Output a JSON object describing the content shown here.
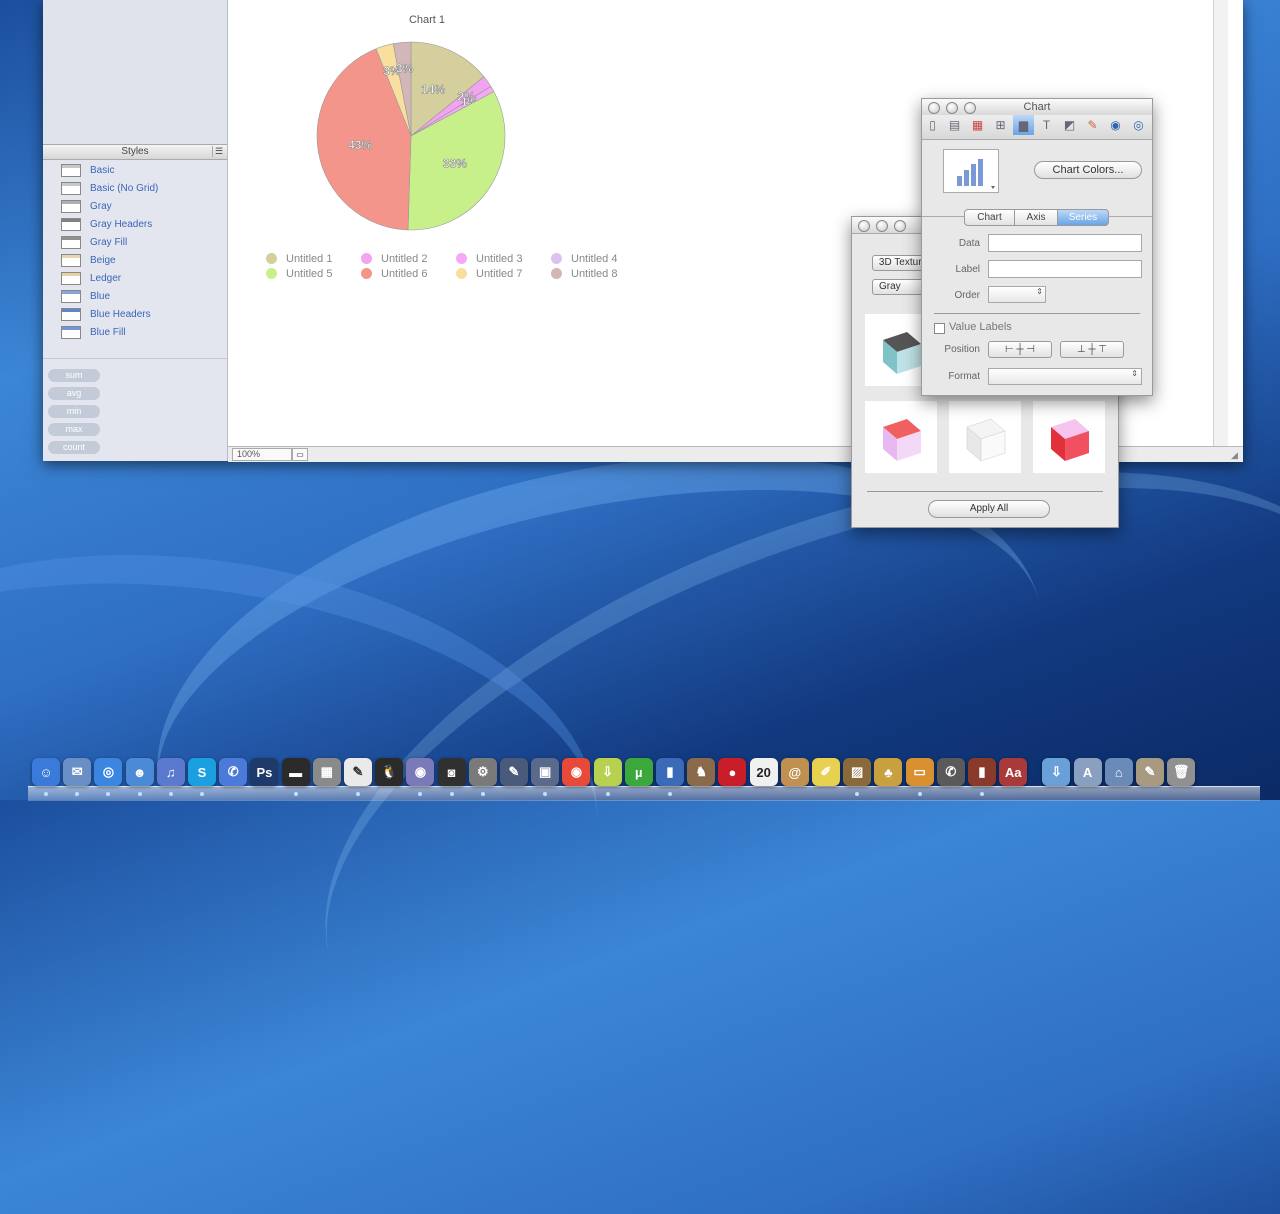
{
  "sidebar": {
    "styles_header": "Styles",
    "styles": [
      {
        "label": "Basic",
        "header_color": "#c8c8c8"
      },
      {
        "label": "Basic (No Grid)",
        "header_color": "#c8c8c8"
      },
      {
        "label": "Gray",
        "header_color": "#b0b0b0"
      },
      {
        "label": "Gray Headers",
        "header_color": "#808080"
      },
      {
        "label": "Gray Fill",
        "header_color": "#909090"
      },
      {
        "label": "Beige",
        "header_color": "#e8d6b0"
      },
      {
        "label": "Ledger",
        "header_color": "#e6d2a0"
      },
      {
        "label": "Blue",
        "header_color": "#8aa6d8"
      },
      {
        "label": "Blue Headers",
        "header_color": "#5e86cc"
      },
      {
        "label": "Blue Fill",
        "header_color": "#6e96d8"
      }
    ],
    "functions": [
      "sum",
      "avg",
      "min",
      "max",
      "count"
    ]
  },
  "status": {
    "zoom": "100%"
  },
  "chart_data": {
    "type": "pie",
    "title": "Chart 1",
    "slices": [
      {
        "name": "Untitled 1",
        "value": 14,
        "color": "#d4cf9c"
      },
      {
        "name": "Untitled 2",
        "value": 2,
        "color": "#f2a4f0"
      },
      {
        "name": "Untitled 3",
        "value": 1,
        "color": "#f4a8f6"
      },
      {
        "name": "Untitled 5",
        "value": 33,
        "color": "#c8f08a"
      },
      {
        "name": "Untitled 6",
        "value": 43,
        "color": "#f4958c"
      },
      {
        "name": "Untitled 7",
        "value": 3,
        "color": "#f8df9e"
      },
      {
        "name": "Untitled 8",
        "value": 3,
        "color": "#d2b6b8"
      }
    ],
    "labels": [
      "14%",
      "2%",
      "1%",
      "33%",
      "43%",
      "3%",
      "3%"
    ],
    "legend": [
      {
        "name": "Untitled 1",
        "color": "#d4cf9c"
      },
      {
        "name": "Untitled 2",
        "color": "#f2a4f0"
      },
      {
        "name": "Untitled 3",
        "color": "#f4a8f6"
      },
      {
        "name": "Untitled 4",
        "color": "#dcc2ec"
      },
      {
        "name": "Untitled 5",
        "color": "#c8f08a"
      },
      {
        "name": "Untitled 6",
        "color": "#f4958c"
      },
      {
        "name": "Untitled 7",
        "color": "#f8df9e"
      },
      {
        "name": "Untitled 8",
        "color": "#d2b6b8"
      }
    ],
    "legend_position": "bottom"
  },
  "chart_inspector": {
    "title": "Chart",
    "chart_colors_button": "Chart Colors...",
    "tabs": [
      "Chart",
      "Axis",
      "Series"
    ],
    "selected_tab": "Series",
    "data_label": "Data",
    "data_value": "",
    "label_label": "Label",
    "label_value": "",
    "order_label": "Order",
    "value_labels_checkbox": "Value Labels",
    "value_labels_checked": false,
    "position_label": "Position",
    "format_label": "Format"
  },
  "chart_colors_panel": {
    "texture_select": "3D Texture",
    "color_select": "Gray",
    "apply_all_button": "Apply All"
  },
  "dock": {
    "apps": [
      "Finder",
      "Preview",
      "Safari",
      "iChat",
      "iTunes",
      "Skype",
      "iChat AV",
      "Photoshop",
      "Activity Monitor",
      "Calculator",
      "TextEdit",
      "Adium",
      "Instruments",
      "Aperture",
      "System Preferences",
      "Script Editor",
      "VMware Fusion",
      "Chrome",
      "Transmission",
      "uTorrent",
      "Numbers",
      "Chess",
      "Tuneup",
      "iCal",
      "Address Book",
      "Stickies",
      "iPhoto",
      "Pinata",
      "Keynote",
      "Image Capture",
      "iMovie",
      "Dictionary",
      "Downloads",
      "Applications",
      "Home",
      "Documents",
      "Trash"
    ],
    "ical_date": "20"
  }
}
